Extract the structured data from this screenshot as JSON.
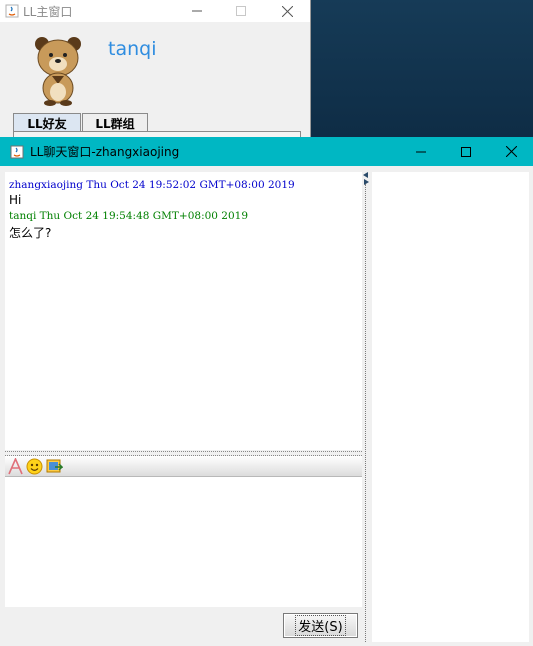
{
  "main_window": {
    "title": "LL主窗口",
    "username": "tanqi",
    "tabs": [
      {
        "label": "LL好友"
      },
      {
        "label": "LL群组"
      }
    ]
  },
  "chat_window": {
    "title": "LL聊天窗口-zhangxiaojing",
    "accent_color": "#00b7c3",
    "messages": [
      {
        "header": "zhangxiaojing Thu Oct 24 19:52:02 GMT+08:00 2019",
        "text": "Hi",
        "header_color": "#0000cc"
      },
      {
        "header": "tanqi Thu Oct 24 19:54:48 GMT+08:00 2019",
        "text": "怎么了?",
        "header_color": "#008000"
      }
    ],
    "toolbar": {
      "icons": [
        "font-icon",
        "emoji-icon",
        "image-icon"
      ]
    },
    "send_button_label": "发送(S)",
    "input_value": ""
  }
}
